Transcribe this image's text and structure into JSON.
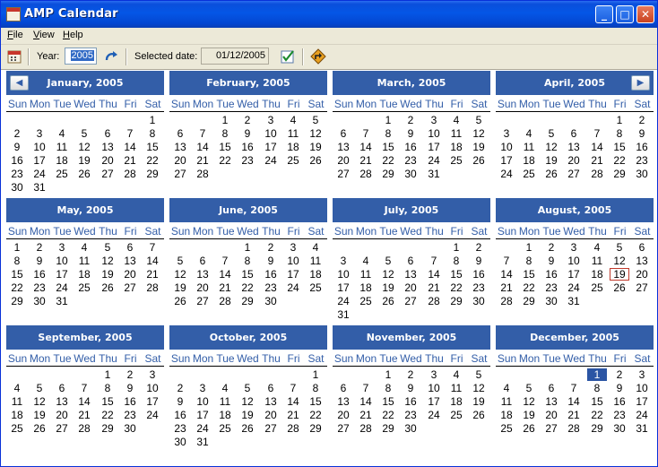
{
  "window": {
    "title": "AMP Calendar",
    "controls": {
      "minimize": "_",
      "maximize": "□",
      "close": "✕"
    }
  },
  "menu": [
    {
      "key": "F",
      "rest": "ile"
    },
    {
      "key": "V",
      "rest": "iew"
    },
    {
      "key": "H",
      "rest": "elp"
    }
  ],
  "toolbar": {
    "year_label": "Year:",
    "year_value": "2005",
    "selected_label": "Selected date:",
    "selected_value": "01/12/2005",
    "icons": [
      "calendar-icon",
      "refresh-icon",
      "check-icon",
      "directions-icon"
    ]
  },
  "weekdays": [
    "Sun",
    "Mon",
    "Tue",
    "Wed",
    "Thu",
    "Fri",
    "Sat"
  ],
  "nav": {
    "prev": "◀",
    "next": "▶"
  },
  "months": [
    {
      "title": "January, 2005",
      "first_weekday": 6,
      "days": 31
    },
    {
      "title": "February, 2005",
      "first_weekday": 2,
      "days": 28
    },
    {
      "title": "March, 2005",
      "first_weekday": 2,
      "days": 31
    },
    {
      "title": "April, 2005",
      "first_weekday": 5,
      "days": 30
    },
    {
      "title": "May, 2005",
      "first_weekday": 0,
      "days": 31
    },
    {
      "title": "June, 2005",
      "first_weekday": 3,
      "days": 30
    },
    {
      "title": "July, 2005",
      "first_weekday": 5,
      "days": 31
    },
    {
      "title": "August, 2005",
      "first_weekday": 1,
      "days": 31
    },
    {
      "title": "September, 2005",
      "first_weekday": 4,
      "days": 30
    },
    {
      "title": "October, 2005",
      "first_weekday": 6,
      "days": 31
    },
    {
      "title": "November, 2005",
      "first_weekday": 2,
      "days": 30
    },
    {
      "title": "December, 2005",
      "first_weekday": 4,
      "days": 31
    }
  ],
  "highlights": {
    "selected": {
      "month": 11,
      "day": 1
    },
    "today": {
      "month": 7,
      "day": 19
    }
  },
  "colors": {
    "header_bg": "#335ea8",
    "weekday_text": "#335ea8",
    "selected_bg": "#2b55a4",
    "today_border": "#c0392b"
  }
}
